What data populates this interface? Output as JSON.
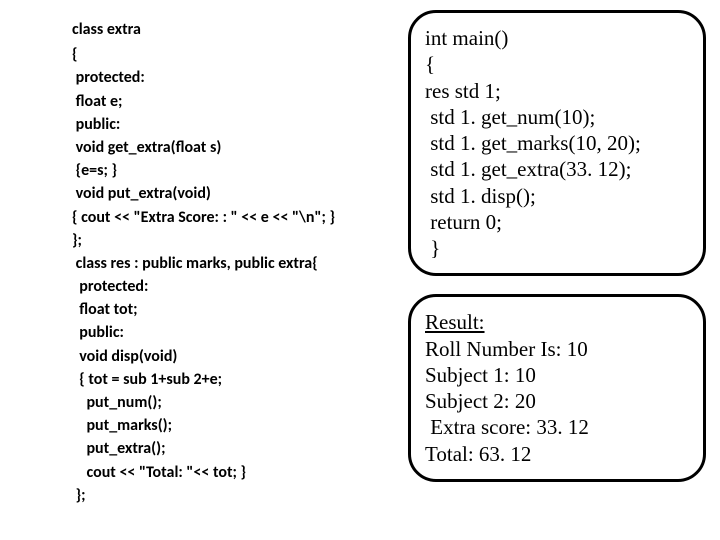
{
  "left": {
    "r1": "class extra",
    "r2": "{",
    "r3": " protected:",
    "r4": " float e;",
    "r5": " public:",
    "r6": " void get_extra(float s)",
    "r7": " {e=s; }",
    "r8": " void put_extra(void)",
    "r9": "{ cout << \"Extra Score: : \" << e << \"\\n\"; }",
    "r10": "};",
    "r11": " class res : public marks, public extra{",
    "r12": "  protected:",
    "r13": "  float tot;",
    "r14": "  public:",
    "r15": "  void disp(void)",
    "r16": "  { tot = sub 1+sub 2+e;",
    "r17": "    put_num();",
    "r18": "    put_marks();",
    "r19": "    put_extra();",
    "r20": "    cout << \"Total: \"<< tot; }",
    "r21": " };"
  },
  "main_panel": {
    "l1": "int main()",
    "l2": "{",
    "l3": "res std 1;",
    "l4": " std 1. get_num(10);",
    "l5": " std 1. get_marks(10, 20);",
    "l6": " std 1. get_extra(33. 12);",
    "l7": " std 1. disp();",
    "l8": " return 0;",
    "l9": " }"
  },
  "result_panel": {
    "header": "Result:",
    "o1": "Roll Number Is: 10",
    "o2": "Subject 1: 10",
    "o3": "Subject 2: 20",
    "o4": " Extra score: 33. 12",
    "o5": "Total: 63. 12"
  }
}
